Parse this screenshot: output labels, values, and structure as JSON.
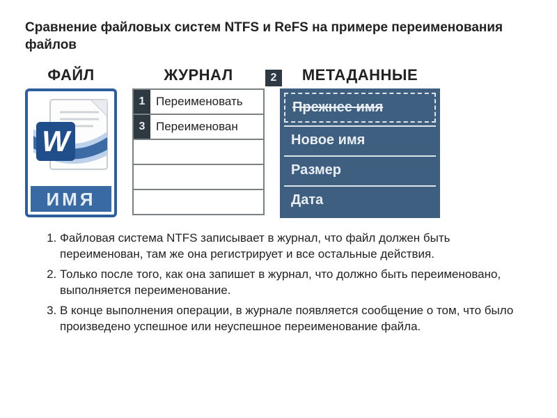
{
  "title": "Сравнение файловых систем NTFS и ReFS на примере переименования файлов",
  "columns": {
    "file": "ФАЙЛ",
    "journal": "ЖУРНАЛ",
    "meta": "МЕТАДАННЫЕ"
  },
  "file": {
    "name_label": "ИМЯ"
  },
  "journal": {
    "rows": [
      {
        "step": "1",
        "label": "Переименовать"
      },
      {
        "step": "3",
        "label": "Переименован"
      },
      {
        "step": "",
        "label": ""
      },
      {
        "step": "",
        "label": ""
      },
      {
        "step": "",
        "label": ""
      }
    ],
    "connector_step": "2"
  },
  "metadata": {
    "old_name": "Прежнее имя",
    "new_name": "Новое имя",
    "size": "Размер",
    "date": "Дата"
  },
  "steps": [
    "Файловая система NTFS записывает в журнал, что файл должен быть переименован, там же она регистрирует и все остальные действия.",
    "Только после того, как она запишет в журнал, что должно быть переименовано, выполняется переименование.",
    "В конце выполнения операции, в журнале появляется сообщение о том, что было произведено успешное или неуспешное переименование файла."
  ]
}
